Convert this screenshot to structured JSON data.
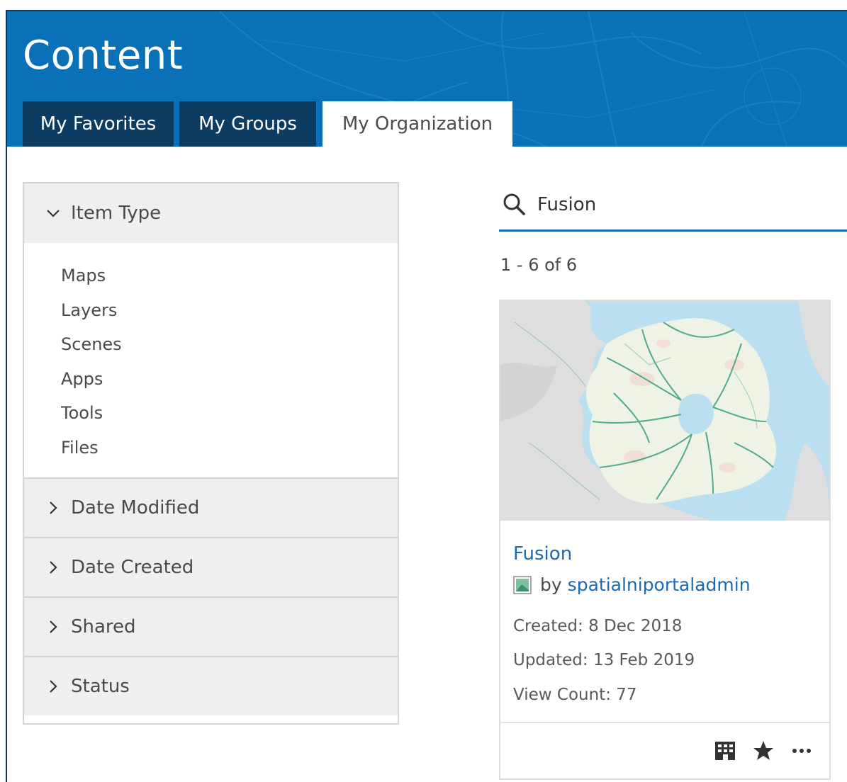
{
  "header": {
    "title": "Content",
    "tabs": [
      {
        "label": "My Favorites"
      },
      {
        "label": "My Groups"
      },
      {
        "label": "My Organization"
      }
    ]
  },
  "filters": {
    "item_type": {
      "label": "Item Type",
      "options": [
        "Maps",
        "Layers",
        "Scenes",
        "Apps",
        "Tools",
        "Files"
      ]
    },
    "collapsed": [
      "Date Modified",
      "Date Created",
      "Shared",
      "Status"
    ]
  },
  "search": {
    "value": "Fusion"
  },
  "results": {
    "count_text": "1 - 6 of 6"
  },
  "card": {
    "title": "Fusion",
    "by_label": "by",
    "owner": "spatialniportaladmin",
    "created": "Created: 8 Dec 2018",
    "updated": "Updated: 13 Feb 2019",
    "view_count": "View Count: 77",
    "actions": [
      "organization-icon",
      "favorite-star-icon",
      "more-options-icon"
    ]
  },
  "colors": {
    "header_blue": "#0a70b8",
    "tab_dark": "#0d3c63",
    "link_blue": "#1a6ab3"
  }
}
